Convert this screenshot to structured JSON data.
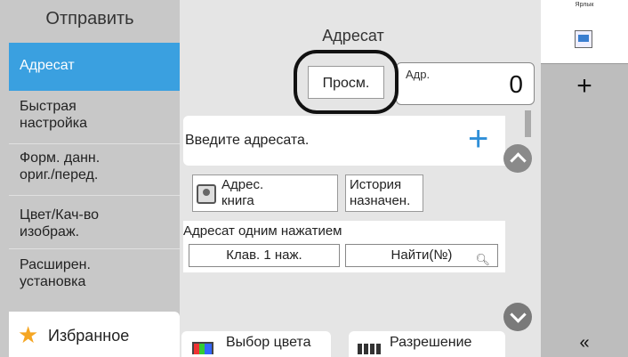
{
  "sidebar": {
    "title": "Отправить",
    "items": [
      {
        "line1": "Адресат",
        "line2": ""
      },
      {
        "line1": "Быстрая",
        "line2": "настройка"
      },
      {
        "line1": "Форм. данн.",
        "line2": "ориг./перед."
      },
      {
        "line1": "Цвет/Кач-во",
        "line2": "изображ."
      },
      {
        "line1": "Расширен.",
        "line2": "установка"
      }
    ],
    "favorites_label": "Избранное",
    "favorites_icon": "star-icon"
  },
  "main": {
    "title": "Адресат",
    "view_button": "Просм.",
    "address": {
      "label": "Адр.",
      "count": "0"
    },
    "dest_input_text": "Введите адресата.",
    "add_icon": "plus-icon",
    "address_book": {
      "line1": "Адрес.",
      "line2": "книга"
    },
    "history": {
      "line1": "История",
      "line2": "назначен."
    },
    "one_touch": {
      "title": "Адресат одним нажатием",
      "key_button": "Клав. 1 наж.",
      "search_button": "Найти(№)",
      "search_icon": "search-icon"
    },
    "bottom_tiles": {
      "color": "Выбор цвета",
      "resolution": "Разрешение"
    }
  },
  "right_panel": {
    "title": "Ярлык",
    "add_icon": "+",
    "collapse_icon": "«"
  },
  "colors": {
    "accent_blue": "#3aa0e0",
    "favorite_star": "#f5a623",
    "plus_blue": "#2f8fd8"
  }
}
